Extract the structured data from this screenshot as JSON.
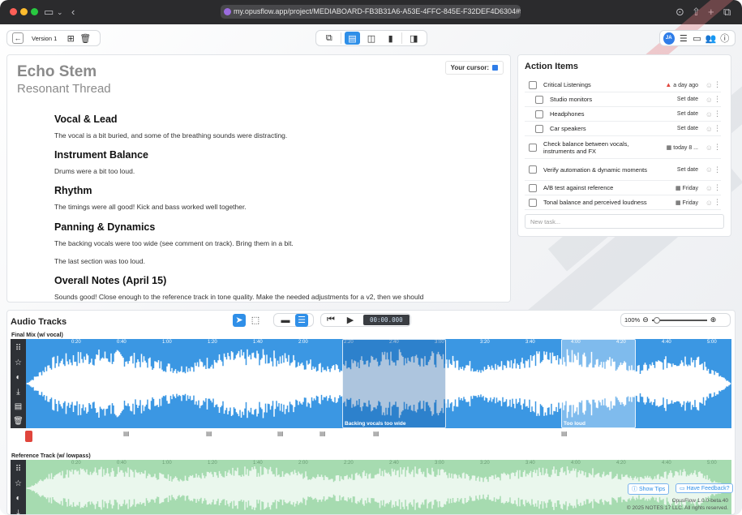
{
  "browser": {
    "url": "my.opusflow.app/project/MEDIABOARD-FB3B31A6-A53E-4FFC-845E-F32DEF4D6304#tab-new0"
  },
  "toolbar": {
    "version_label": "Version 1",
    "avatar_initials": "JA"
  },
  "document": {
    "title": "Echo Stem",
    "subtitle": "Resonant Thread",
    "cursor_label": "Your cursor:",
    "sections": [
      {
        "heading": "Vocal & Lead",
        "paragraphs": [
          "The vocal is a bit buried, and some of the breathing sounds were distracting."
        ]
      },
      {
        "heading": "Instrument Balance",
        "paragraphs": [
          "Drums were a bit too loud."
        ]
      },
      {
        "heading": "Rhythm",
        "paragraphs": [
          "The timings were all good! Kick and bass worked well together."
        ]
      },
      {
        "heading": "Panning & Dynamics",
        "paragraphs": [
          "The backing vocals were too wide (see comment on track). Bring them in a bit.",
          "The last section was too loud."
        ]
      },
      {
        "heading": "Overall Notes (April 15)",
        "paragraphs": [
          "Sounds good! Close enough to the reference track in tone quality. Make the needed adjustments for a v2, then we should"
        ]
      }
    ]
  },
  "action_items": {
    "title": "Action Items",
    "items": [
      {
        "text": "Critical Listenings",
        "due": "a day ago",
        "indent": false,
        "warn": true
      },
      {
        "text": "Studio monitors",
        "due": "Set date",
        "indent": true
      },
      {
        "text": "Headphones",
        "due": "Set date",
        "indent": true
      },
      {
        "text": "Car speakers",
        "due": "Set date",
        "indent": true
      },
      {
        "text": "Check balance between vocals, instruments and FX",
        "due": "today 8 ...",
        "indent": false,
        "cal": true
      },
      {
        "text": "Verify automation & dynamic moments",
        "due": "Set date",
        "indent": false
      },
      {
        "text": "A/B test against reference",
        "due": "Friday",
        "indent": false,
        "cal": true
      },
      {
        "text": "Tonal balance and perceived loudness",
        "due": "Friday",
        "indent": false,
        "cal": true
      }
    ],
    "new_task_placeholder": "New task..."
  },
  "audio": {
    "title": "Audio Tracks",
    "time": "00:00.000",
    "zoom": "100%",
    "tracks": [
      {
        "name": "Final Mix (w/ vocal)",
        "regions": [
          "Backing vocals too wide",
          "Too loud"
        ]
      },
      {
        "name": "Reference Track (w/ lowpass)",
        "regions": []
      }
    ],
    "timecodes": [
      "0:20",
      "0:40",
      "1:00",
      "1:20",
      "1:40",
      "2:00",
      "2:20",
      "2:40",
      "3:00",
      "3:20",
      "3:40",
      "4:00",
      "4:20",
      "4:40",
      "5:00"
    ],
    "colors": {
      "track1": "#3b97e3",
      "track1_dark": "#2472bd",
      "track2": "#a6dbb0",
      "track2_dark": "#7ec48c"
    }
  },
  "footer": {
    "show_tips": "Show Tips",
    "feedback": "Have Feedback?",
    "version": "OpusFlow 1.0.0-beta.40",
    "copyright": "© 2025 NOTES 17 LLC. All rights reserved."
  }
}
